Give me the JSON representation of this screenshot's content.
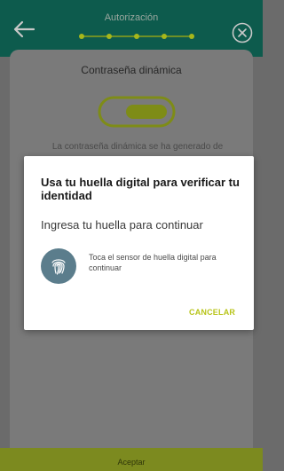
{
  "header": {
    "title": "Autorización",
    "steps_total": 5,
    "steps_completed": 4
  },
  "card": {
    "title": "Contraseña dinámica",
    "description": "La contraseña dinámica se ha generado de"
  },
  "footer": {
    "button_label": "Aceptar"
  },
  "dialog": {
    "title": "Usa tu huella digital para verificar tu identidad",
    "subtitle": "Ingresa tu huella para continuar",
    "sensor_hint": "Toca el sensor de huella digital para continuar",
    "cancel_label": "CANCELAR"
  },
  "colors": {
    "header_bg": "#0d5b4d",
    "accent": "#b8c41a",
    "fingerprint_bg": "#5b7d8c",
    "overlay_bg": "#6b6b6b"
  },
  "icons": {
    "back": "back-arrow-icon",
    "close": "close-icon",
    "toggle": "toggle-icon",
    "fingerprint": "fingerprint-icon"
  }
}
